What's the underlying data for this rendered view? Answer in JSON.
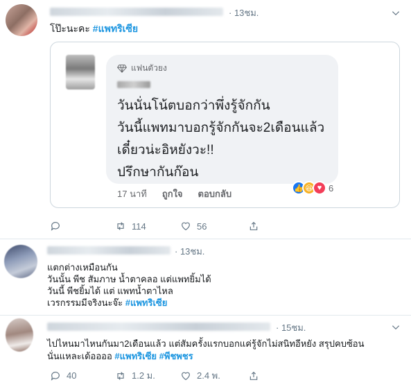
{
  "tweet1": {
    "time": "13ชม.",
    "text": "โป๊ะนะคะ",
    "hashtag": "#แพทริเซีย",
    "quote": {
      "badge": "แฟนตัวยง",
      "lines": [
        "วันนั่นโน้ตบอกว่าพึ่งรู้จักกัน",
        "วันนี้แพทมาบอกรู้จักกันจะ2เดือนแล้ว",
        "เดี๋ยวน่ะอิหยังวะ!!",
        "ปรึกษากันก๊อน"
      ],
      "meta_time": "17 นาที",
      "meta_like": "ถูกใจ",
      "meta_reply": "ตอบกลับ",
      "reaction_count": "6"
    },
    "retweets": "114",
    "likes": "56"
  },
  "tweet2": {
    "time": "13ชม.",
    "lines": [
      "แตกต่างเหมือนกัน",
      "วันนั้น พีช สัมภาษ น้ำตาคลอ แต่แพทยิ้มได้",
      "วันนี้ พีชยิ้มได้ แต่ แพทน้ำตาไหล",
      "เวรกรรมมีจริงนะจ๊ะ"
    ],
    "hashtag": "#แพทริเซีย"
  },
  "tweet3": {
    "time": "15ชม.",
    "line1": "ไปไหนมาไหนกันมา2เดือนแล้ว แต่สัมครั้งแรกบอกแค่รู้จักไม่สนิทอีหยัง สรุปคบซ้อน",
    "line2": "นั่นแหละเด้ออออ",
    "hashtag1": "#แพทริเซีย",
    "hashtag2": "#พีชพชร",
    "replies": "40",
    "retweets": "1.2 ม.",
    "likes": "2.4 พ."
  },
  "colors": {
    "hashtag": "#1b95e0",
    "meta": "#657786",
    "bubble": "#f0f2f5"
  }
}
